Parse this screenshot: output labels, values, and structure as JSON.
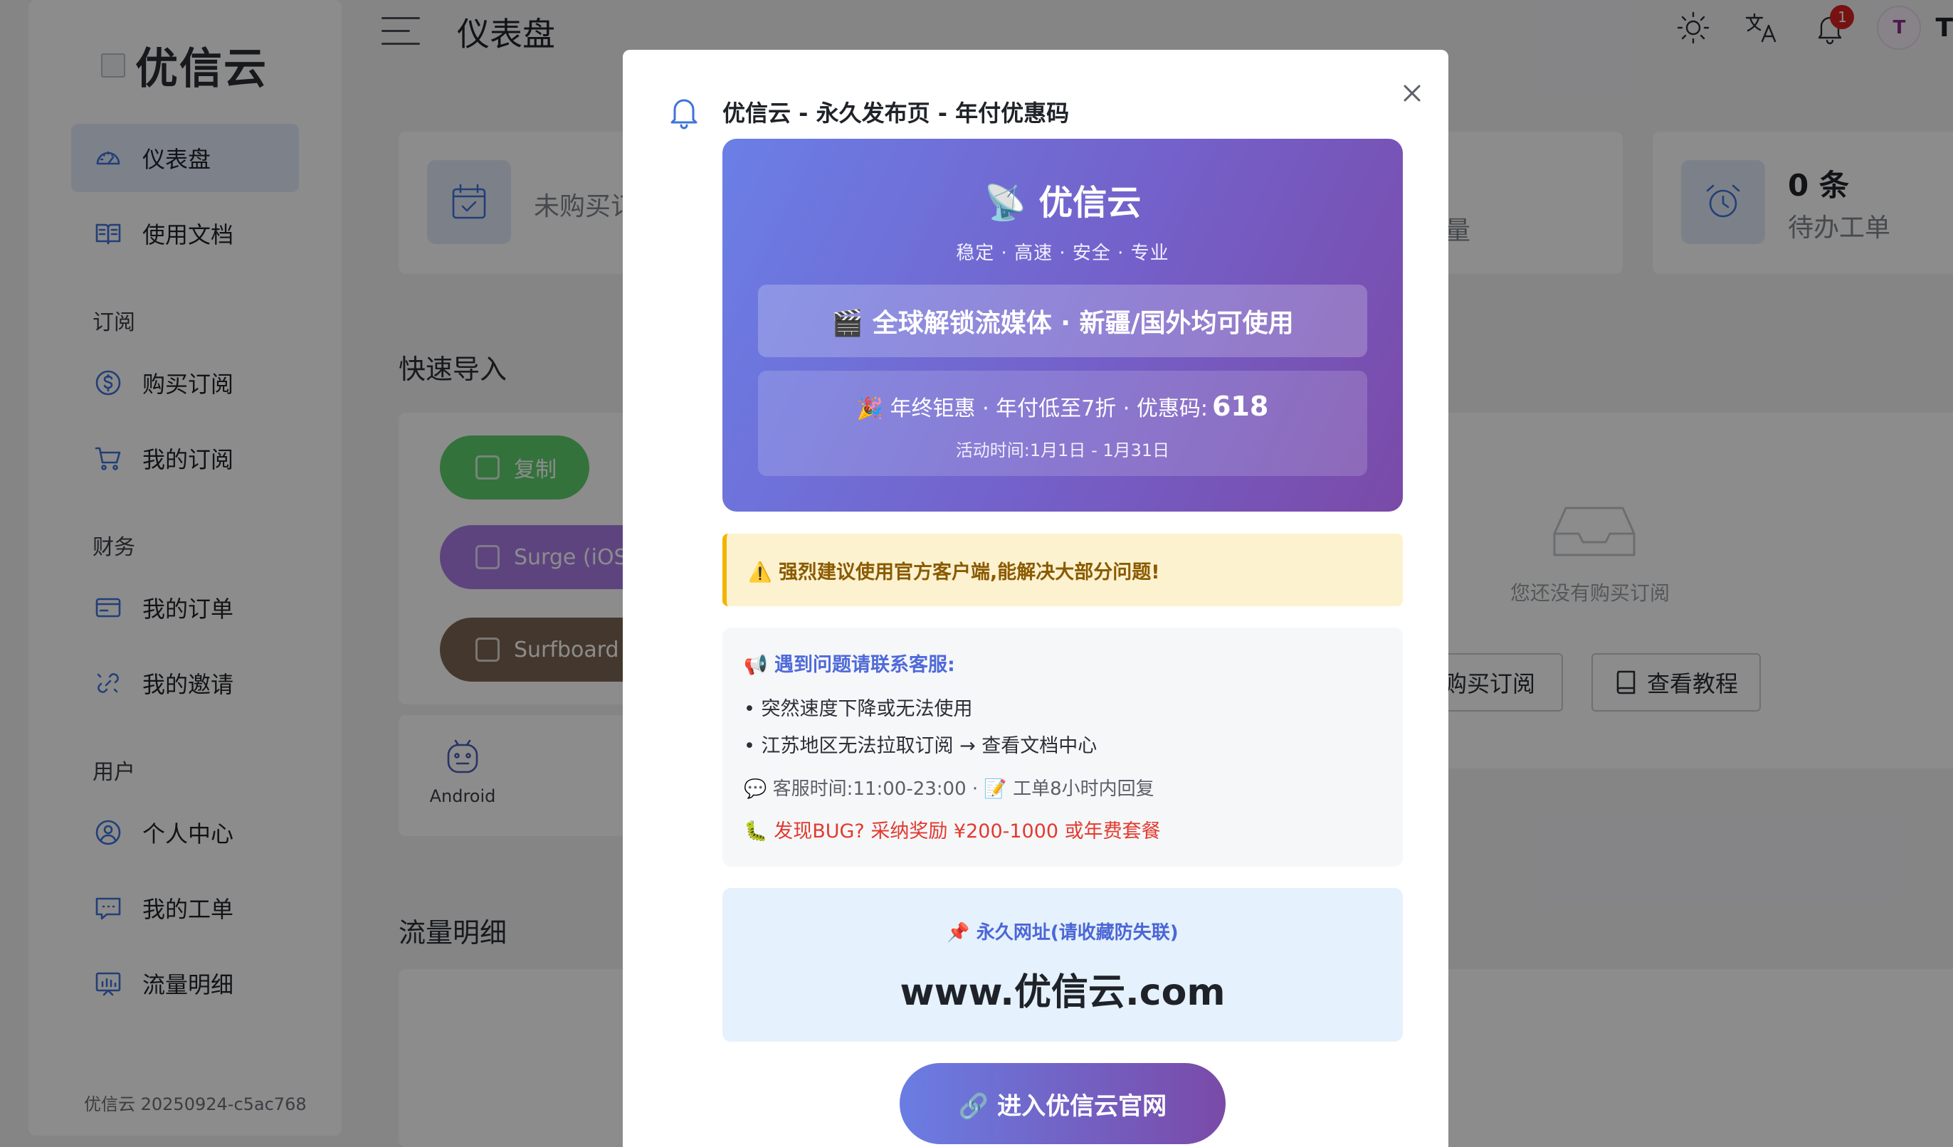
{
  "app": {
    "brand": "优信云",
    "page_title": "仪表盘",
    "version": "优信云 20250924-c5ac768"
  },
  "sidebar": {
    "items": [
      {
        "label": "仪表盘",
        "icon": "dashboard-icon",
        "active": true
      },
      {
        "label": "使用文档",
        "icon": "book-icon"
      }
    ],
    "sections": [
      {
        "title": "订阅",
        "items": [
          {
            "label": "购买订阅",
            "icon": "dollar-icon"
          },
          {
            "label": "我的订阅",
            "icon": "cart-icon"
          }
        ]
      },
      {
        "title": "财务",
        "items": [
          {
            "label": "我的订单",
            "icon": "card-icon"
          },
          {
            "label": "我的邀请",
            "icon": "link-icon"
          }
        ]
      },
      {
        "title": "用户",
        "items": [
          {
            "label": "个人中心",
            "icon": "user-icon"
          },
          {
            "label": "我的工单",
            "icon": "chat-icon"
          },
          {
            "label": "流量明细",
            "icon": "chart-icon"
          }
        ]
      }
    ]
  },
  "header": {
    "icons": [
      "sun-icon",
      "translate-icon",
      "bell-icon"
    ],
    "notification_count": "1",
    "avatar_letter": "T",
    "avatar_name": "T"
  },
  "dashboard": {
    "stats": [
      {
        "label": "未购买订",
        "icon": "calendar-icon"
      },
      {
        "label": "量"
      },
      {
        "value": "0 条",
        "label": "待办工单",
        "icon": "alarm-icon"
      }
    ],
    "quick_import_title": "快速导入",
    "quick_import_buttons": [
      "复制",
      "Surge (iOS",
      "Surfboard"
    ],
    "android_label": "Android",
    "empty_text": "您还没有购买订阅",
    "buy_button": "购买订阅",
    "tutorial_button": "查看教程",
    "traffic_title": "流量明细"
  },
  "modal": {
    "title": "优信云 - 永久发布页 - 年付优惠码",
    "hero": {
      "title": "📡 优信云",
      "subtitle": "稳定 · 高速 · 安全 · 专业",
      "streaming": "🎬 全球解锁流媒体 · 新疆/国外均可使用",
      "promo": "🎉 年终钜惠 · 年付低至7折 · 优惠码:",
      "promo_code": "618",
      "promo_time": "活动时间:1月1日 - 1月31日"
    },
    "warning": "⚠️ 强烈建议使用官方客户端,能解决大部分问题!",
    "support": {
      "heading": "📢 遇到问题请联系客服:",
      "lines": [
        "• 突然速度下降或无法使用",
        "• 江苏地区无法拉取订阅 → 查看文档中心"
      ],
      "hours": "💬 客服时间:11:00-23:00 · 📝 工单8小时内回复",
      "bug": "🐛 发现BUG? 采纳奖励 ¥200-1000 或年费套餐"
    },
    "url": {
      "label": "📌 永久网址(请收藏防失联)",
      "value": "www.优信云.com"
    },
    "cta": "🔗 进入优信云官网"
  },
  "colors": {
    "accent": "#3f73d9",
    "hero_gradient_start": "#6a7fe6",
    "hero_gradient_end": "#7a4aa8",
    "warning_bg": "#fdf2cf",
    "danger": "#e23a2f"
  }
}
